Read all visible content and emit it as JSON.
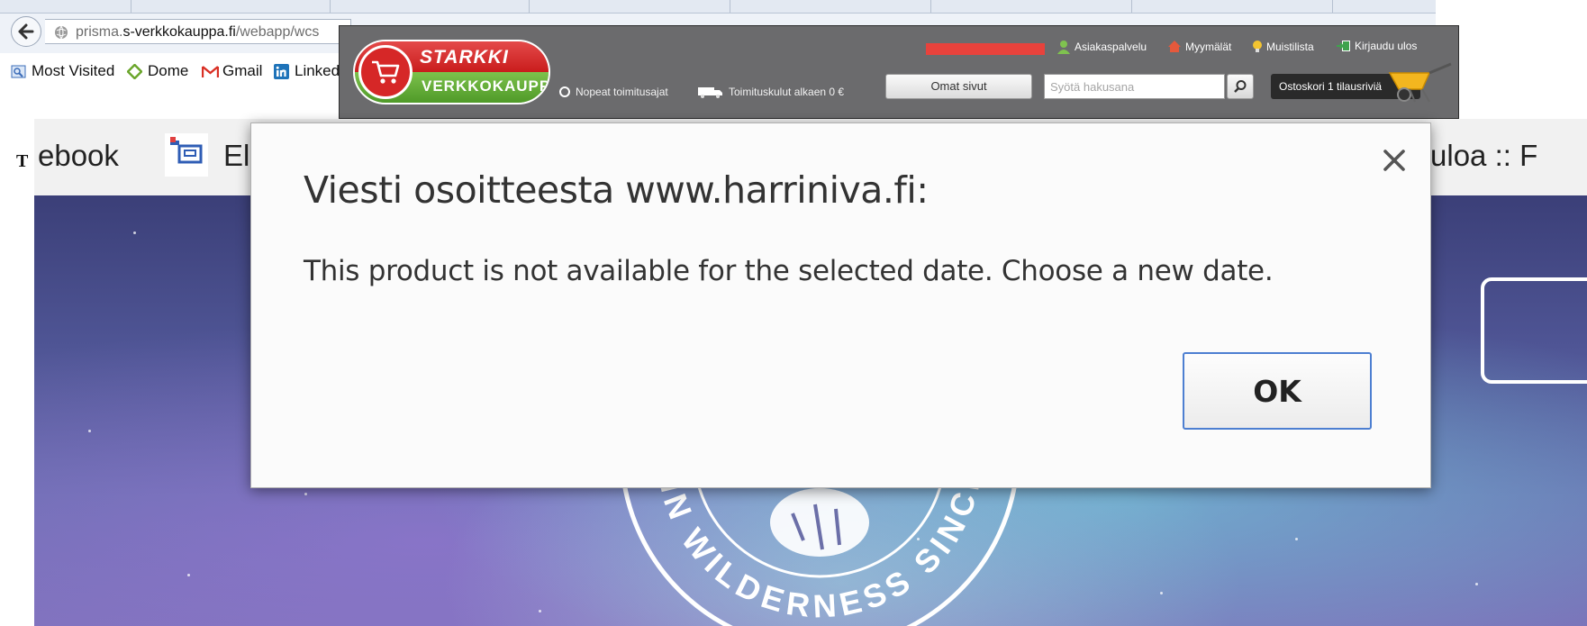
{
  "firefox": {
    "url_prefix": "prisma.",
    "url_domain": "s-verkkokauppa.fi",
    "url_path": "/webapp/wcs",
    "bookmarks": [
      {
        "label": "Most Visited",
        "icon": "most-visited-icon"
      },
      {
        "label": "Dome",
        "icon": "dome-diamond-icon"
      },
      {
        "label": "Gmail",
        "icon": "gmail-icon"
      },
      {
        "label": "Linked",
        "icon": "linkedin-icon"
      }
    ]
  },
  "starkki": {
    "logo_top": "STARKKI",
    "logo_bottom": "VERKKOKAUPPA",
    "delivery_fast": "Nopeat toimitusajat",
    "delivery_cost": "Toimituskulut alkaen 0 €",
    "links": {
      "service": "Asiakaspalvelu",
      "stores": "Myymälät",
      "wishlist": "Muistilista",
      "logout": "Kirjaudu ulos"
    },
    "my_pages": "Omat sivut",
    "search_placeholder": "Syötä hakusana",
    "cart": "Ostoskori 1 tilausriviä",
    "colors": {
      "header_bg": "#6b6b6d",
      "red": "#d62727",
      "green": "#5fa832"
    }
  },
  "background_page": {
    "left_fragment": "T",
    "tab_facebook": "ebook",
    "tab_el": "El",
    "tab_right": "vetuloa :: F",
    "emblem_text": "IN WILDERNESS SINCE"
  },
  "dialog": {
    "title": "Viesti osoitteesta www.harriniva.fi:",
    "message": "This product is not available for the selected date. Choose a new date.",
    "ok": "OK",
    "accent": "#4d7fd1"
  }
}
